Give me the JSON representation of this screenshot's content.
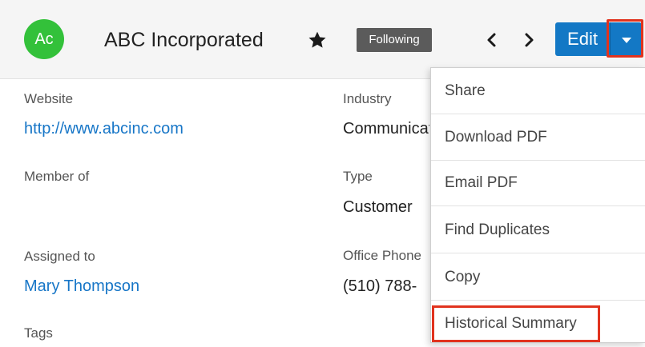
{
  "header": {
    "avatar_initials": "Ac",
    "record_name": "ABC Incorporated",
    "following_label": "Following",
    "edit_label": "Edit"
  },
  "fields": {
    "website": {
      "label": "Website",
      "value": "http://www.abcinc.com"
    },
    "industry": {
      "label": "Industry",
      "value": "Communications"
    },
    "member_of": {
      "label": "Member of",
      "value": ""
    },
    "type": {
      "label": "Type",
      "value": "Customer"
    },
    "assigned_to": {
      "label": "Assigned to",
      "value": "Mary Thompson"
    },
    "office_phone": {
      "label": "Office Phone",
      "value": "(510) 788-"
    },
    "tags": {
      "label": "Tags"
    }
  },
  "dropdown": {
    "items": [
      {
        "label": "Share"
      },
      {
        "label": "Download PDF"
      },
      {
        "label": "Email PDF"
      },
      {
        "label": "Find Duplicates"
      },
      {
        "label": "Copy"
      },
      {
        "label": "Historical Summary"
      }
    ]
  },
  "colors": {
    "avatar": "#33c13a",
    "primary_button": "#1378c5",
    "link": "#1776c7",
    "highlight": "#e1331e",
    "badge": "#5b5b5b"
  },
  "icons": {
    "favorite": "star-icon",
    "previous": "chevron-left-icon",
    "next": "chevron-right-icon",
    "actions": "caret-down-icon"
  }
}
